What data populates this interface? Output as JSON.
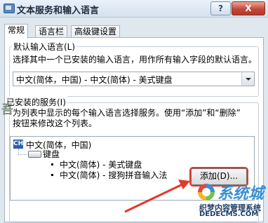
{
  "window": {
    "title": "文本服务和输入语言",
    "help_label": "?",
    "close_label": "X"
  },
  "tabs": [
    {
      "label": "常规",
      "active": true
    },
    {
      "label": "语言栏",
      "active": false
    },
    {
      "label": "高级键设置",
      "active": false
    }
  ],
  "default_language": {
    "group_title": "默认输入语言(L)",
    "description": "选择其中一个已安装的输入语言，用作所有输入字段的默认语言。",
    "selected": "中文(简体，中国) - 中文(简体) - 美式键盘"
  },
  "installed_services": {
    "group_title": "已安装的服务(I)",
    "description_line1": "为列表中显示的每个输入语言选择服务。使用“添加”和“删除”",
    "description_line2": "按钮来修改这个列表。",
    "language_icon": "CH",
    "language": "中文(简体，中国)",
    "category": "键盘",
    "services": [
      "中文(简体) - 美式键盘",
      "中文(简体) - 搜狗拼音输入法"
    ]
  },
  "add_button_label": "添加(D)...",
  "watermark": {
    "left_text": "吾",
    "logo_script": "系统城",
    "line1": "织梦内容管理系统",
    "line2": "DEDECMS.COM"
  },
  "colors": {
    "highlight": "#e03a2c",
    "accent": "#2d5fa8"
  }
}
